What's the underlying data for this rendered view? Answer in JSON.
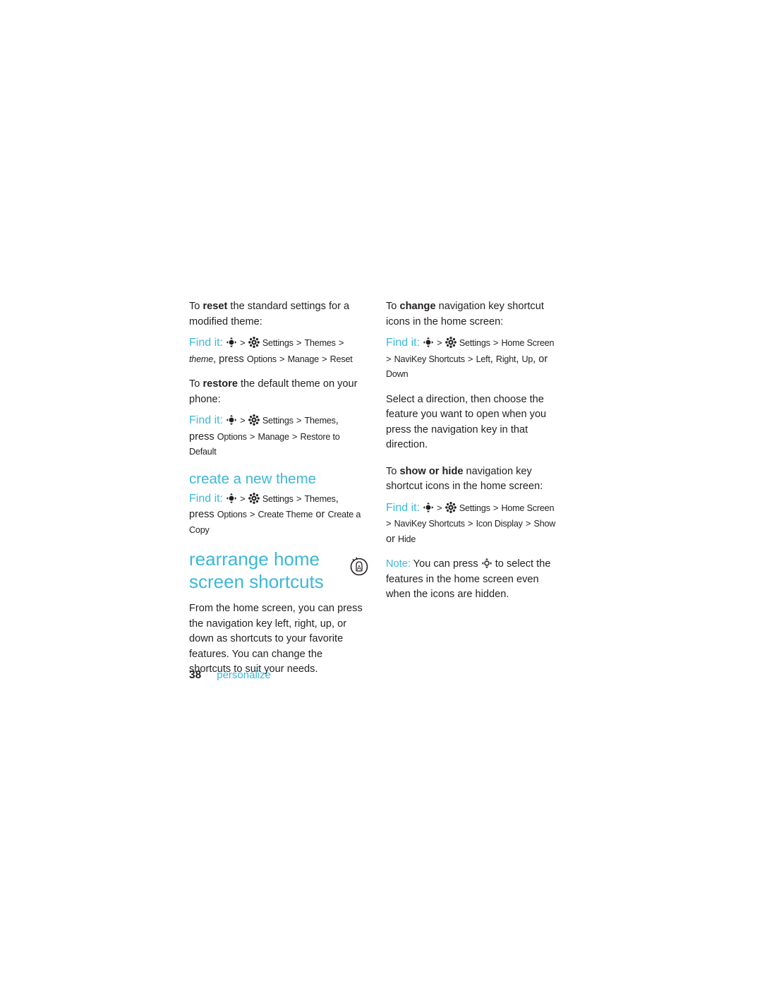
{
  "page": {
    "number": "38",
    "section": "personalize"
  },
  "left_column": {
    "p_reset": {
      "pre": "To ",
      "bold": "reset",
      "post": " the standard settings for a modified theme:"
    },
    "findit_reset": {
      "label": "Find it:",
      "nav_icon": "navigation-key-icon",
      "sep": ">",
      "gear_icon": "settings-gear-icon",
      "item1": "Settings",
      "item2": "Themes",
      "item3": "theme",
      "tail_pre": "press ",
      "tail_items": [
        "Options",
        "Manage",
        "Reset"
      ]
    },
    "p_restore": {
      "pre": "To ",
      "bold": "restore",
      "post": " the default theme on your phone:"
    },
    "findit_restore": {
      "label": "Find it:",
      "nav_icon": "navigation-key-icon",
      "sep": ">",
      "gear_icon": "settings-gear-icon",
      "item1": "Settings",
      "item2": "Themes",
      "tail_pre": "press",
      "tail_items": [
        "Options",
        "Manage",
        "Restore to Default"
      ]
    },
    "heading_create": "create a new theme",
    "findit_create": {
      "label": "Find it:",
      "nav_icon": "navigation-key-icon",
      "sep": ">",
      "gear_icon": "settings-gear-icon",
      "item1": "Settings",
      "item2": "Themes",
      "tail_pre": "press",
      "tail_items": [
        "Options",
        "Create Theme",
        "Create a Copy"
      ],
      "or_word": "or"
    },
    "heading_rearrange": "rearrange home screen shortcuts",
    "p_home": "From the home screen, you can press the navigation key left, right, up, or down as shortcuts to your favorite features. You can change the shortcuts to suit your needs.",
    "margin_icon": "phone-key-icon"
  },
  "right_column": {
    "p_change": {
      "pre": "To ",
      "bold": "change",
      "post": " navigation key shortcut icons in the home screen:"
    },
    "findit_change": {
      "label": "Find it:",
      "nav_icon": "navigation-key-icon",
      "sep": ">",
      "gear_icon": "settings-gear-icon",
      "item1": "Settings",
      "item2": "Home Screen",
      "line2_items": [
        "NaviKey Shortcuts",
        "Left",
        "Right",
        "Up",
        "Down"
      ],
      "line2_prefix": ">",
      "line2_or": "or"
    },
    "p_direction": "Select a direction, then choose the feature you want to open when you press the navigation key in that direction.",
    "p_showhide": {
      "pre": "To ",
      "bold": "show or hide",
      "post": " navigation key shortcut icons in the home screen:"
    },
    "findit_showhide": {
      "label": "Find it:",
      "nav_icon": "navigation-key-icon",
      "sep": ">",
      "gear_icon": "settings-gear-icon",
      "item1": "Settings",
      "item2": "Home Screen",
      "line2_prefix": ">",
      "line2_items": [
        "NaviKey Shortcuts",
        "Icon Display",
        "Show",
        "Hide"
      ],
      "line2_or": "or"
    },
    "note": {
      "label": "Note:",
      "pre": " You can press ",
      "icon": "navigation-key-icon",
      "post": " to select the features in the home screen even when the icons are hidden."
    }
  },
  "colors": {
    "accent": "#3bb8d8",
    "text": "#231f20",
    "background": "#ffffff"
  }
}
